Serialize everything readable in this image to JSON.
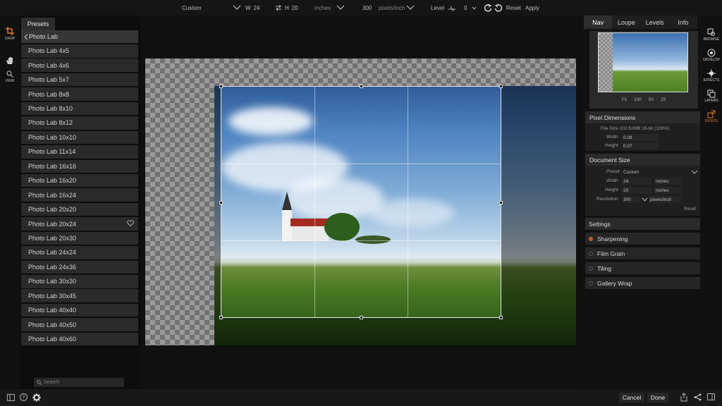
{
  "topbar": {
    "preset_value": "Custom",
    "width_label": "W",
    "width_value": "24",
    "height_label": "H",
    "height_value": "20",
    "units_value": "inches",
    "resolution_value": "300",
    "res_units_value": "pixels/inch",
    "level_label": "Level",
    "level_value": "0",
    "reset_label": "Reset",
    "apply_label": "Apply"
  },
  "leftrail": {
    "crop_label": "CROP",
    "view_label": "VIEW"
  },
  "presets": {
    "tab_label": "Presets",
    "group_label": "Photo Lab",
    "items": [
      "Photo Lab 4x5",
      "Photo Lab 4x6",
      "Photo Lab 5x7",
      "Photo Lab 8x8",
      "Photo Lab 8x10",
      "Photo Lab 8x12",
      "Photo Lab 10x10",
      "Photo Lab 11x14",
      "Photo Lab 16x16",
      "Photo Lab 16x20",
      "Photo Lab 16x24",
      "Photo Lab 20x20",
      "Photo Lab 20x24",
      "Photo Lab 20x30",
      "Photo Lab 24x24",
      "Photo Lab 24x36",
      "Photo Lab 30x30",
      "Photo Lab 30x45",
      "Photo Lab 40x40",
      "Photo Lab 40x50",
      "Photo Lab 40x60"
    ],
    "search_placeholder": "Search"
  },
  "rightpanel": {
    "tabs": [
      "Nav",
      "Loupe",
      "Levels",
      "Info"
    ],
    "zoom_levels": [
      "Fit",
      "100",
      "50",
      "25"
    ],
    "pixel_dimensions": {
      "title": "Pixel Dimensions",
      "file_size": "File Size 102.52MB 16-bit (100%)",
      "width_label": "Width",
      "width_value": "0.08",
      "height_label": "Height",
      "height_value": "0.07"
    },
    "document_size": {
      "title": "Document Size",
      "preset_label": "Preset",
      "preset_value": "Custom",
      "width_label": "Width",
      "width_value": "24",
      "width_units": "inches",
      "height_label": "Height",
      "height_value": "20",
      "height_units": "inches",
      "resolution_label": "Resolution",
      "resolution_value": "300",
      "resolution_units": "pixels/inch",
      "reset_label": "Reset"
    },
    "settings": {
      "title": "Settings",
      "items": [
        "Sharpening",
        "Film Grain",
        "Tiling",
        "Gallery Wrap"
      ]
    }
  },
  "farright": {
    "items": [
      "BROWSE",
      "DEVELOP",
      "EFFECTS",
      "LAYERS",
      "RESIZE"
    ]
  },
  "bottombar": {
    "cancel_label": "Cancel",
    "done_label": "Done"
  },
  "colors": {
    "accent": "#e0762c",
    "panel": "#2a2a2a"
  }
}
